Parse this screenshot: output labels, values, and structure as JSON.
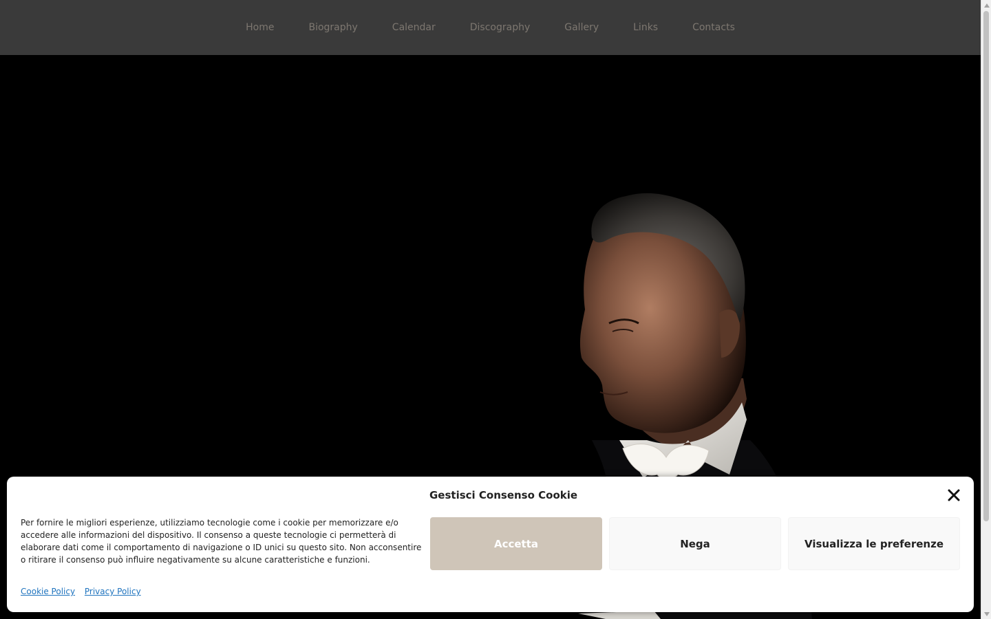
{
  "nav": {
    "items": [
      {
        "label": "Home"
      },
      {
        "label": "Biography"
      },
      {
        "label": "Calendar"
      },
      {
        "label": "Discography"
      },
      {
        "label": "Gallery"
      },
      {
        "label": "Links"
      },
      {
        "label": "Contacts"
      }
    ]
  },
  "colors": {
    "nav_background": "#3a3a3a",
    "nav_text": "#7d7770",
    "accent_button": "#cfc5b8",
    "link": "#1e73be"
  },
  "cookie": {
    "title": "Gestisci Consenso Cookie",
    "body": "Per fornire le migliori esperienze, utilizziamo tecnologie come i cookie per memorizzare e/o accedere alle informazioni del dispositivo. Il consenso a queste tecnologie ci permetterà di elaborare dati come il comportamento di navigazione o ID unici su questo sito. Non acconsentire o ritirare il consenso può influire negativamente su alcune caratteristiche e funzioni.",
    "accept_label": "Accetta",
    "deny_label": "Nega",
    "preferences_label": "Visualizza le preferenze",
    "cookie_policy_label": "Cookie Policy",
    "privacy_policy_label": "Privacy Policy",
    "close_icon": "close-icon"
  },
  "hero": {
    "image": "portrait-photo"
  }
}
